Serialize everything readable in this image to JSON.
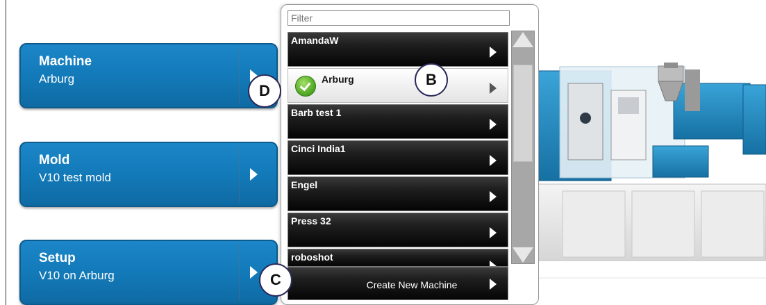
{
  "nav_cards": [
    {
      "title": "Machine",
      "subtitle": "Arburg"
    },
    {
      "title": "Mold",
      "subtitle": "V10 test mold"
    },
    {
      "title": "Setup",
      "subtitle": "V10 on Arburg"
    }
  ],
  "dropdown": {
    "filter_placeholder": "Filter",
    "items": [
      {
        "label": "AmandaW",
        "selected": false
      },
      {
        "label": "Arburg",
        "selected": true
      },
      {
        "label": "Barb test 1",
        "selected": false
      },
      {
        "label": "Cinci India1",
        "selected": false
      },
      {
        "label": "Engel",
        "selected": false
      },
      {
        "label": "Press 32",
        "selected": false
      },
      {
        "label": "roboshot",
        "selected": false
      }
    ],
    "create_label": "Create New Machine"
  },
  "callouts": {
    "b": "B",
    "c": "C",
    "d": "D"
  },
  "colors": {
    "card_blue": "#137ab9",
    "list_dark": "#050505",
    "scrollbar": "#a7a7a7",
    "check_green": "#5bb02b"
  }
}
